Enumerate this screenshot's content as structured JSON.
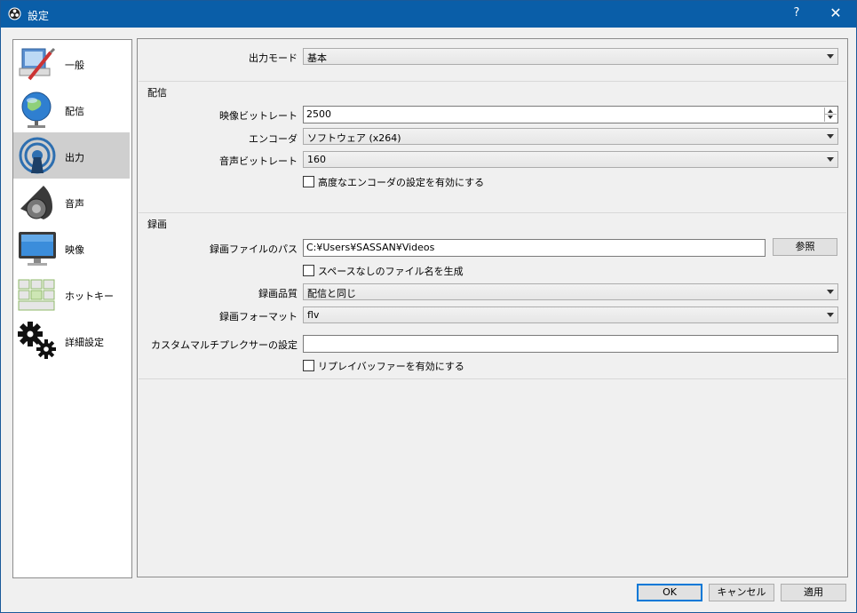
{
  "window": {
    "title": "設定",
    "help_label": "?",
    "close_label": "✕"
  },
  "sidebar": {
    "items": [
      {
        "label": "一般",
        "icon": "general-icon"
      },
      {
        "label": "配信",
        "icon": "stream-globe-icon"
      },
      {
        "label": "出力",
        "icon": "output-antenna-icon",
        "selected": true
      },
      {
        "label": "音声",
        "icon": "speaker-icon"
      },
      {
        "label": "映像",
        "icon": "monitor-icon"
      },
      {
        "label": "ホットキー",
        "icon": "keyboard-icon"
      },
      {
        "label": "詳細設定",
        "icon": "gears-icon"
      }
    ]
  },
  "output_mode": {
    "label": "出力モード",
    "value": "基本"
  },
  "streaming": {
    "title": "配信",
    "video_bitrate_label": "映像ビットレート",
    "video_bitrate_value": "2500",
    "encoder_label": "エンコーダ",
    "encoder_value": "ソフトウェア (x264)",
    "audio_bitrate_label": "音声ビットレート",
    "audio_bitrate_value": "160",
    "advanced_encoder_label": "高度なエンコーダの設定を有効にする"
  },
  "recording": {
    "title": "録画",
    "path_label": "録画ファイルのパス",
    "path_value": "C:¥Users¥SASSAN¥Videos",
    "browse_label": "参照",
    "no_space_label": "スペースなしのファイル名を生成",
    "quality_label": "録画品質",
    "quality_value": "配信と同じ",
    "format_label": "録画フォーマット",
    "format_value": "flv",
    "muxer_label": "カスタムマルチプレクサーの設定",
    "muxer_value": "",
    "replay_buffer_label": "リプレイバッファーを有効にする"
  },
  "buttons": {
    "ok": "OK",
    "cancel": "キャンセル",
    "apply": "適用"
  },
  "colors": {
    "titlebar": "#0a5ea8",
    "selected_item": "#cfcfcf",
    "default_button_border": "#0078d7"
  }
}
